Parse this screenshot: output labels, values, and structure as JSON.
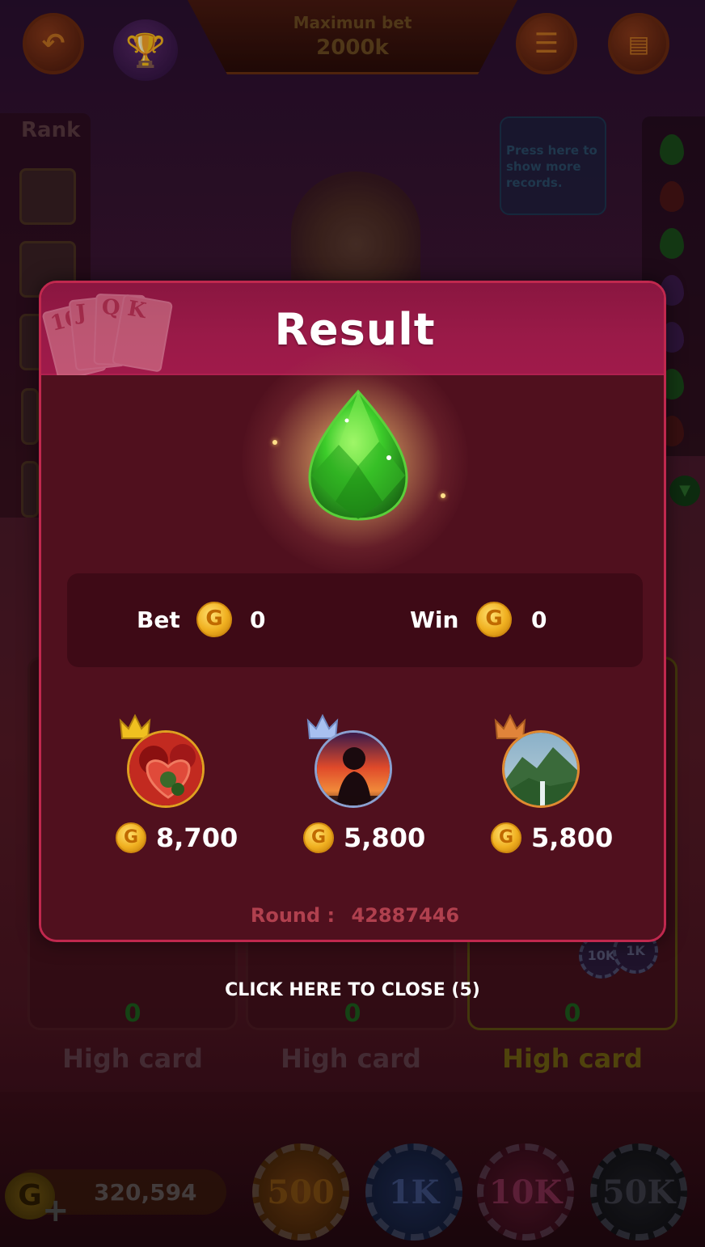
{
  "header": {
    "max_bet_label": "Maximun bet",
    "max_bet_value": "2000k",
    "back_icon": "back-arrow-icon",
    "trophy_icon": "trophy-icon",
    "menu_icon": "list-menu-icon",
    "history_icon": "history-sheet-icon"
  },
  "rank": {
    "label": "Rank"
  },
  "records_tip": "Press here to show more records.",
  "table": {
    "slots": [
      {
        "value": "0",
        "hand": "High card"
      },
      {
        "value": "0",
        "hand": "High card"
      },
      {
        "value": "0",
        "hand": "High card"
      }
    ],
    "mini_chips": [
      "10K",
      "1K"
    ]
  },
  "bottom": {
    "balance": "320,594",
    "coin_glyph": "G",
    "add_glyph": "+",
    "chips": [
      "500",
      "1K",
      "10K",
      "50K"
    ]
  },
  "result": {
    "title": "Result",
    "gem_icon": "green-emerald-gem-icon",
    "bet_label": "Bet",
    "bet_value": "0",
    "win_label": "Win",
    "win_value": "0",
    "coin_glyph": "G",
    "winners": [
      {
        "crown": "gold",
        "amount": "8,700"
      },
      {
        "crown": "silver",
        "amount": "5,800"
      },
      {
        "crown": "bronze",
        "amount": "5,800"
      }
    ],
    "round_label": "Round :",
    "round_value": "42887446",
    "card_letters": [
      "10",
      "J",
      "Q",
      "K"
    ]
  },
  "close_hint": "CLICK HERE TO CLOSE (5)",
  "colors": {
    "modal_border": "#c0284e",
    "modal_header": "#9a1a48",
    "modal_body": "#50101e",
    "round_text": "#b0404e",
    "coin": "#f0b020"
  }
}
